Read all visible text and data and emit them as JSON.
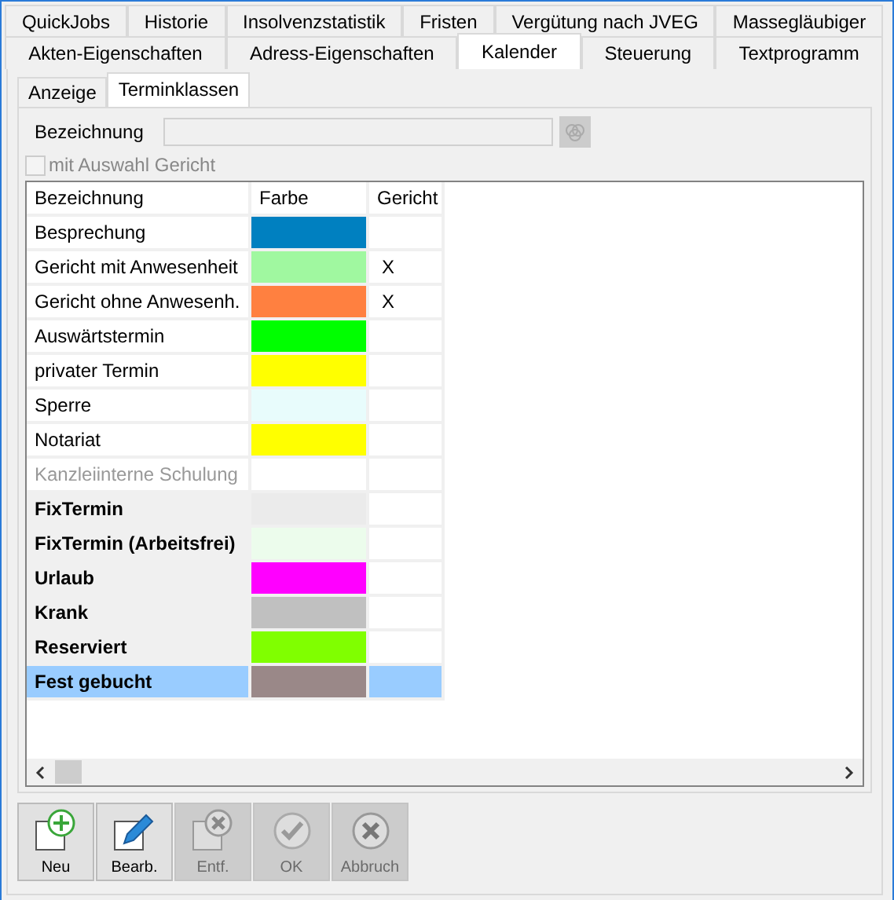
{
  "tabs_top": [
    {
      "label": "QuickJobs",
      "selected": false
    },
    {
      "label": "Historie",
      "selected": false
    },
    {
      "label": "Insolvenzstatistik",
      "selected": false
    },
    {
      "label": "Fristen",
      "selected": false
    },
    {
      "label": "Vergütung nach JVEG",
      "selected": false
    },
    {
      "label": "Massegläubiger",
      "selected": false
    }
  ],
  "tabs_bottom": [
    {
      "label": "Akten-Eigenschaften",
      "selected": false
    },
    {
      "label": "Adress-Eigenschaften",
      "selected": false
    },
    {
      "label": "Kalender",
      "selected": true
    },
    {
      "label": "Steuerung",
      "selected": false
    },
    {
      "label": "Textprogramm",
      "selected": false
    }
  ],
  "subtabs": [
    {
      "label": "Anzeige",
      "selected": false
    },
    {
      "label": "Terminklassen",
      "selected": true
    }
  ],
  "form": {
    "label": "Bezeichnung",
    "disabled": true,
    "checkbox_label": "mit Auswahl Gericht",
    "checkbox_checked": false
  },
  "table": {
    "columns": [
      "Bezeichnung",
      "Farbe",
      "Gericht"
    ],
    "rows": [
      {
        "name": "Besprechung",
        "color": "#0080c0",
        "court": "",
        "bold": false,
        "disabled": false,
        "selected": false
      },
      {
        "name": "Gericht mit Anwesenheit",
        "color": "#a0f8a0",
        "court": "X",
        "bold": false,
        "disabled": false,
        "selected": false
      },
      {
        "name": "Gericht ohne Anwesenh.",
        "color": "#ff8040",
        "court": "X",
        "bold": false,
        "disabled": false,
        "selected": false
      },
      {
        "name": "Auswärtstermin",
        "color": "#00ff00",
        "court": "",
        "bold": false,
        "disabled": false,
        "selected": false
      },
      {
        "name": "privater Termin",
        "color": "#ffff00",
        "court": "",
        "bold": false,
        "disabled": false,
        "selected": false
      },
      {
        "name": "Sperre",
        "color": "#e8fcfc",
        "court": "",
        "bold": false,
        "disabled": false,
        "selected": false
      },
      {
        "name": "Notariat",
        "color": "#ffff00",
        "court": "",
        "bold": false,
        "disabled": false,
        "selected": false
      },
      {
        "name": "Kanzleiinterne Schulung",
        "color": "#ffffff",
        "court": "",
        "bold": false,
        "disabled": true,
        "selected": false
      },
      {
        "name": "FixTermin",
        "color": "#ebebeb",
        "court": "",
        "bold": true,
        "disabled": false,
        "selected": false
      },
      {
        "name": "FixTermin (Arbeitsfrei)",
        "color": "#ecfcec",
        "court": "",
        "bold": true,
        "disabled": false,
        "selected": false
      },
      {
        "name": "Urlaub",
        "color": "#ff00ff",
        "court": "",
        "bold": true,
        "disabled": false,
        "selected": false
      },
      {
        "name": "Krank",
        "color": "#c0c0c0",
        "court": "",
        "bold": true,
        "disabled": false,
        "selected": false
      },
      {
        "name": "Reserviert",
        "color": "#80ff00",
        "court": "",
        "bold": true,
        "disabled": false,
        "selected": false
      },
      {
        "name": "Fest gebucht",
        "color": "#9a8888",
        "court": "",
        "bold": true,
        "disabled": false,
        "selected": true
      }
    ]
  },
  "buttons": [
    {
      "label": "Neu",
      "kind": "new",
      "disabled": false
    },
    {
      "label": "Bearb.",
      "kind": "edit",
      "disabled": false
    },
    {
      "label": "Entf.",
      "kind": "delete",
      "disabled": true
    },
    {
      "label": "OK",
      "kind": "ok",
      "disabled": true
    },
    {
      "label": "Abbruch",
      "kind": "cancel",
      "disabled": true
    }
  ]
}
